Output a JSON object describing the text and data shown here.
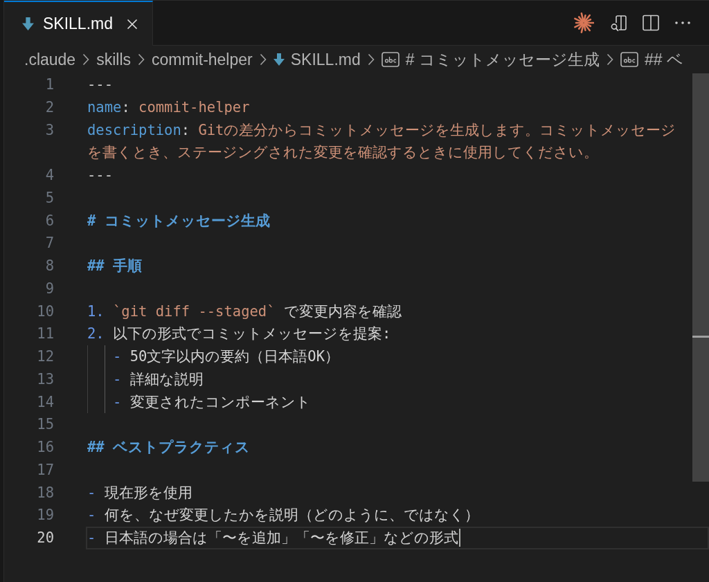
{
  "tabs": [
    {
      "label": "SKILL.md",
      "selected": true
    }
  ],
  "breadcrumbs": [
    {
      "kind": "folder",
      "label": ".claude"
    },
    {
      "kind": "folder",
      "label": "skills"
    },
    {
      "kind": "folder",
      "label": "commit-helper"
    },
    {
      "kind": "file",
      "label": "SKILL.md"
    },
    {
      "kind": "symbol",
      "label": "# コミットメッセージ生成"
    },
    {
      "kind": "symbol",
      "label": "## ベ"
    }
  ],
  "editor": {
    "lines": [
      {
        "number": "1",
        "selected": false,
        "tokens": [
          {
            "kind": "delimiter",
            "text": "---"
          }
        ]
      },
      {
        "number": "2",
        "selected": false,
        "tokens": [
          {
            "kind": "key",
            "text": "name"
          },
          {
            "kind": "colon",
            "text": ":"
          },
          {
            "kind": "string",
            "text": "commit-helper"
          }
        ]
      },
      {
        "number": "3",
        "selected": false,
        "tokens": [
          {
            "kind": "key",
            "text": "description"
          },
          {
            "kind": "colon",
            "text": ":"
          },
          {
            "kind": "string",
            "text": "Gitの差分からコミットメッセージを生成します。コミットメッセージ"
          }
        ],
        "wrapped": [
          {
            "kind": "string",
            "text": "を書くとき、ステージングされた変更を確認するときに使用してください。"
          }
        ]
      },
      {
        "number": "4",
        "selected": false,
        "tokens": [
          {
            "kind": "delimiter",
            "text": "---"
          }
        ]
      },
      {
        "number": "5",
        "selected": false
      },
      {
        "number": "6",
        "selected": false,
        "tokens": [
          {
            "kind": "heading",
            "text": "# コミットメッセージ生成"
          }
        ]
      },
      {
        "number": "7",
        "selected": false
      },
      {
        "number": "8",
        "selected": false,
        "tokens": [
          {
            "kind": "heading",
            "text": "## 手順"
          }
        ]
      },
      {
        "number": "9",
        "selected": false
      },
      {
        "number": "10",
        "selected": false,
        "tokens": [
          {
            "kind": "marker",
            "text": "1."
          },
          {
            "kind": "code",
            "text": "`git diff --staged`"
          },
          {
            "kind": "text",
            "text": "で変更内容を確認"
          }
        ]
      },
      {
        "number": "11",
        "selected": false,
        "tokens": [
          {
            "kind": "marker",
            "text": "2."
          },
          {
            "kind": "text",
            "text": "以下の形式でコミットメッセージを提案:"
          }
        ],
        "children": [
          {
            "number": "12",
            "selected": false,
            "tokens": [
              {
                "kind": "marker",
                "text": "-"
              },
              {
                "kind": "text",
                "text": "50文字以内の要約（日本語OK）"
              }
            ]
          },
          {
            "number": "13",
            "selected": false,
            "tokens": [
              {
                "kind": "marker",
                "text": "-"
              },
              {
                "kind": "text",
                "text": "詳細な説明"
              }
            ]
          },
          {
            "number": "14",
            "selected": false,
            "tokens": [
              {
                "kind": "marker",
                "text": "-"
              },
              {
                "kind": "text",
                "text": "変更されたコンポーネント"
              }
            ]
          }
        ]
      },
      {
        "number": "15",
        "selected": false
      },
      {
        "number": "16",
        "selected": false,
        "tokens": [
          {
            "kind": "heading",
            "text": "## ベストプラクティス"
          }
        ]
      },
      {
        "number": "17",
        "selected": false
      },
      {
        "number": "18",
        "selected": false,
        "tokens": [
          {
            "kind": "marker",
            "text": "-"
          },
          {
            "kind": "text",
            "text": "現在形を使用"
          }
        ]
      },
      {
        "number": "19",
        "selected": false,
        "tokens": [
          {
            "kind": "marker",
            "text": "-"
          },
          {
            "kind": "text",
            "text": "何を、なぜ変更したかを説明（どのように、ではなく）"
          }
        ]
      },
      {
        "number": "20",
        "selected": true,
        "tokens": [
          {
            "kind": "marker",
            "text": "-"
          },
          {
            "kind": "text",
            "text": "日本語の場合は「〜を追加」「〜を修正」などの形式"
          }
        ]
      }
    ]
  }
}
